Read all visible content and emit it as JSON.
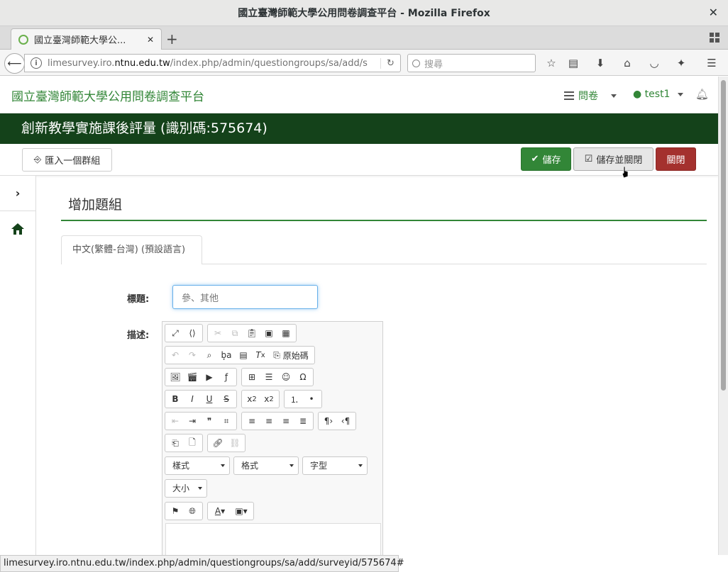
{
  "window": {
    "title": "國立臺灣師範大學公用問卷調查平台 - Mozilla Firefox"
  },
  "tab": {
    "label": "國立臺灣師範大學公..."
  },
  "urlbar": {
    "prefix": "limesurvey.iro.",
    "domain": "ntnu.edu.tw",
    "path": "/index.php/admin/questiongroups/sa/add/s"
  },
  "search": {
    "placeholder": "搜尋"
  },
  "app": {
    "brand": "國立臺灣師範大學公用問卷調查平台",
    "menu_surveys": "問卷",
    "menu_user": "test1"
  },
  "survey": {
    "title": "創新教學實施課後評量 (識別碼:575674)"
  },
  "toolbar": {
    "import_label": "匯入一個群組",
    "save_label": "儲存",
    "save_close_label": "儲存並關閉",
    "close_label": "關閉"
  },
  "page": {
    "heading": "增加題組",
    "language_tab": "中文(繁體-台灣) (預設語言)",
    "title_label": "標題:",
    "title_value": "參、其他",
    "description_label": "描述:"
  },
  "editor": {
    "source_label": "原始碼",
    "combo_styles": "樣式",
    "combo_format": "格式",
    "combo_font": "字型",
    "combo_size": "大小"
  },
  "statusbar": {
    "url": "limesurvey.iro.ntnu.edu.tw/index.php/admin/questiongroups/sa/add/surveyid/575674#"
  },
  "colors": {
    "accent": "#328637",
    "header_bg": "#14421a",
    "danger": "#a4312e"
  }
}
